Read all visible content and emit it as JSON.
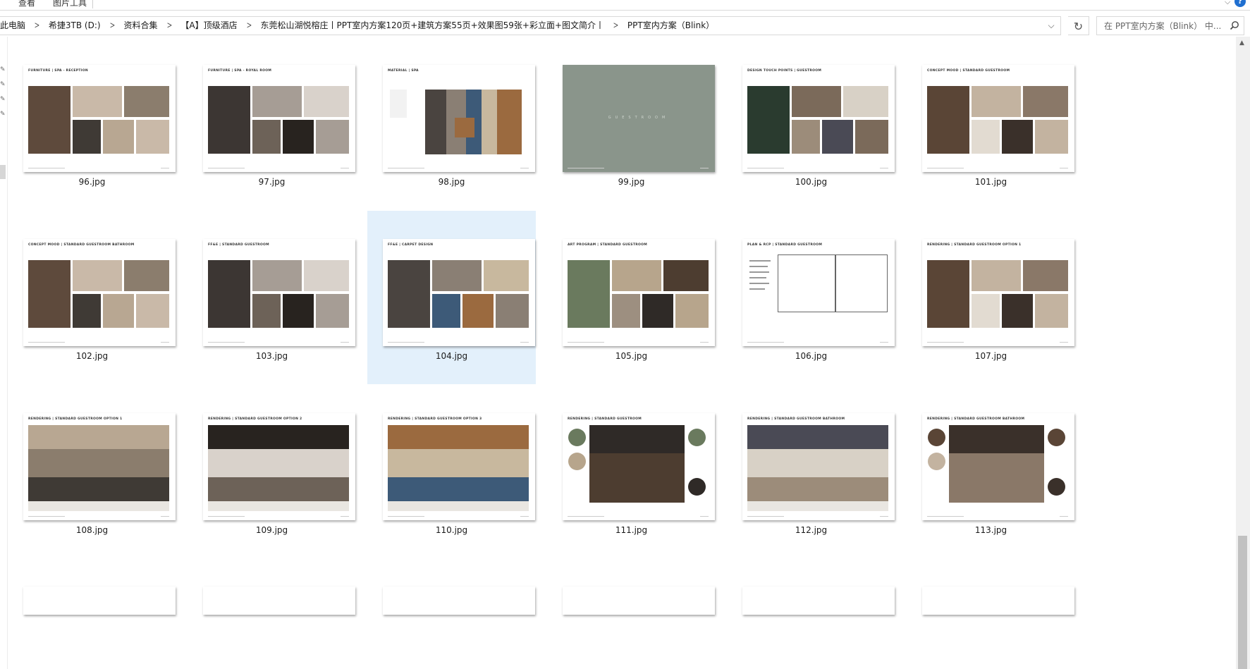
{
  "ribbon": {
    "tabs": [
      "查看",
      "图片工具"
    ]
  },
  "address_bar": {
    "crumbs": [
      "此电脑",
      "希捷3TB (D:)",
      "资料合集",
      "【A】顶级酒店",
      "东莞松山湖悦榕庄丨PPT室内方案120页+建筑方案55页+效果图59张+彩立面+图文简介丨",
      "PPT室内方案（Blink）"
    ],
    "search_placeholder": "在 PPT室内方案（Blink） 中..."
  },
  "files": [
    {
      "name": "96.jpg",
      "head": "FURNITURE | SPA - RECEPTION"
    },
    {
      "name": "97.jpg",
      "head": "FURNITURE | SPA - ROYAL ROOM"
    },
    {
      "name": "98.jpg",
      "head": "MATERIAL | SPA"
    },
    {
      "name": "99.jpg",
      "head": "",
      "center": "GUESTROOM"
    },
    {
      "name": "100.jpg",
      "head": "DESIGN TOUCH POINTS | GUESTROOM"
    },
    {
      "name": "101.jpg",
      "head": "CONCEPT MOOD | STANDARD GUESTROOM"
    },
    {
      "name": "102.jpg",
      "head": "CONCEPT MOOD | STANDARD GUESTROOM BATHROOM"
    },
    {
      "name": "103.jpg",
      "head": "FF&E | STANDARD GUESTROOM"
    },
    {
      "name": "104.jpg",
      "head": "FF&E | CARPET DESIGN",
      "selected": true
    },
    {
      "name": "105.jpg",
      "head": "ART PROGRAM | STANDARD GUESTROOM"
    },
    {
      "name": "106.jpg",
      "head": "PLAN & RCP | STANDARD GUESTROOM"
    },
    {
      "name": "107.jpg",
      "head": "RENDERING | STANDARD GUESTROOM OPTION 1"
    },
    {
      "name": "108.jpg",
      "head": "RENDERING | STANDARD GUESTROOM OPTION 1"
    },
    {
      "name": "109.jpg",
      "head": "RENDERING | STANDARD GUESTROOM OPTION 2"
    },
    {
      "name": "110.jpg",
      "head": "RENDERING | STANDARD GUESTROOM OPTION 3"
    },
    {
      "name": "111.jpg",
      "head": "RENDERING | STANDARD GUESTROOM"
    },
    {
      "name": "112.jpg",
      "head": "RENDERING | STANDARD GUESTROOM BATHROOM"
    },
    {
      "name": "113.jpg",
      "head": "RENDERING | STANDARD GUESTROOM BATHROOM"
    }
  ],
  "colors": {
    "selection": "#e3f0fb",
    "slide_green": "#8a958b",
    "help": "#1f6fd0"
  },
  "icons": {
    "help": "help-icon",
    "dropdown": "chevron-down-icon",
    "refresh": "refresh-icon",
    "search": "search-icon"
  }
}
